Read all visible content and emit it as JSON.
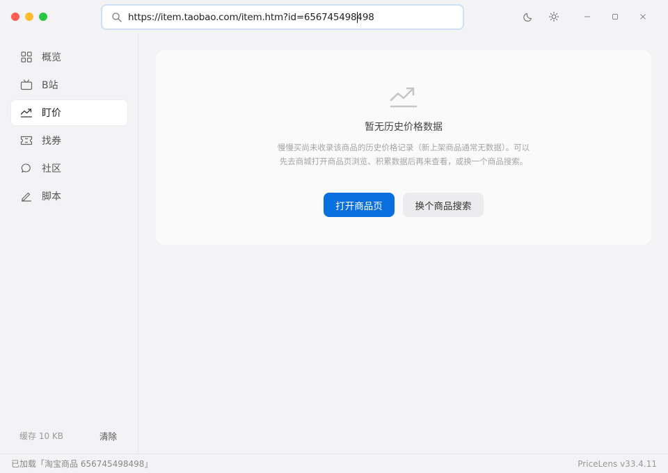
{
  "window": {
    "url": "https://item.taobao.com/item.htm?id=656745498498",
    "icons": [
      "search-icon",
      "moon-icon",
      "sun-icon",
      "minimize-icon",
      "maximize-icon",
      "close-icon"
    ]
  },
  "sidebar": {
    "items": [
      {
        "label": "概览",
        "icon": "grid-icon",
        "active": false
      },
      {
        "label": "B站",
        "icon": "tv-icon",
        "active": false
      },
      {
        "label": "盯价",
        "icon": "trend-icon",
        "active": true
      },
      {
        "label": "找券",
        "icon": "ticket-icon",
        "active": false
      },
      {
        "label": "社区",
        "icon": "chat-icon",
        "active": false
      },
      {
        "label": "脚本",
        "icon": "pen-icon",
        "active": false
      }
    ],
    "cache_text": "缓存 10 KB",
    "clear_label": "清除"
  },
  "main": {
    "empty_title": "暂无历史价格数据",
    "empty_desc": "慢慢买尚未收录该商品的历史价格记录（新上架商品通常无数据）。可以先去商城打开商品页浏览、积累数据后再来查看，或换一个商品搜索。",
    "primary_button": "打开商品页",
    "secondary_button": "换个商品搜索"
  },
  "status": {
    "left": "已加载「淘宝商品 656745498498」",
    "right": "PriceLens v33.4.11"
  },
  "colors": {
    "accent": "#0a6fde",
    "background": "#f3f3f5",
    "card": "#fafafa"
  }
}
